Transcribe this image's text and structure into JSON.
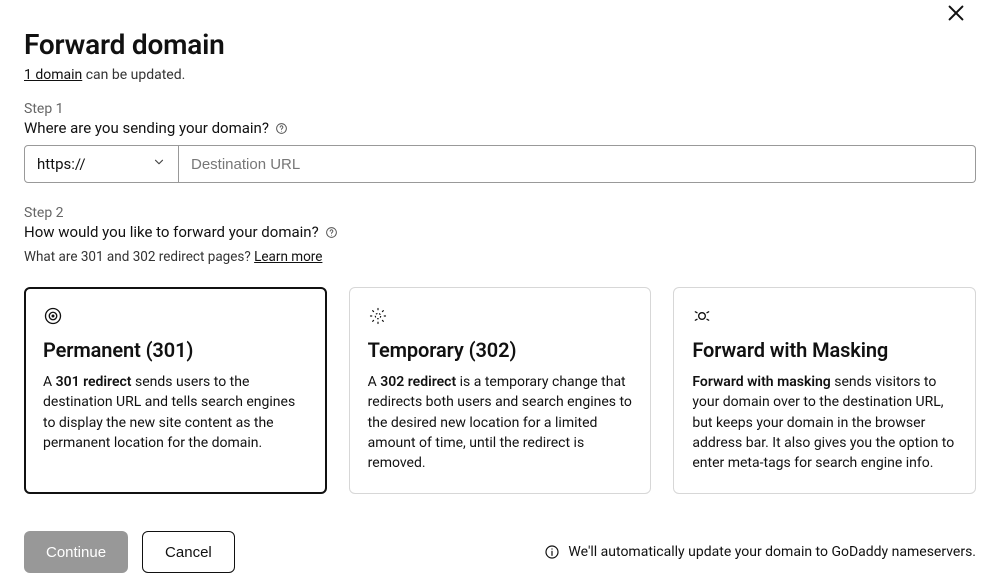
{
  "title": "Forward domain",
  "subtitle_link": "1 domain",
  "subtitle_rest": " can be updated.",
  "step1": {
    "label": "Step 1",
    "question": "Where are you sending your domain?",
    "protocol": "https://",
    "dest_placeholder": "Destination URL",
    "dest_value": ""
  },
  "step2": {
    "label": "Step 2",
    "question": "How would you like to forward your domain?",
    "hint_prefix": "What are 301 and 302 redirect pages? ",
    "learn_more": "Learn more"
  },
  "cards": {
    "permanent": {
      "title": "Permanent (301)",
      "desc_prefix": "A ",
      "desc_bold": "301 redirect",
      "desc_rest": " sends users to the destination URL and tells search engines to display the new site content as the permanent location for the domain."
    },
    "temporary": {
      "title": "Temporary (302)",
      "desc_prefix": "A ",
      "desc_bold": "302 redirect",
      "desc_rest": " is a temporary change that redirects both users and search engines to the desired new location for a limited amount of time, until the redirect is removed."
    },
    "masking": {
      "title": "Forward with Masking",
      "desc_prefix": "",
      "desc_bold": "Forward with masking",
      "desc_rest": " sends visitors to your domain over to the destination URL, but keeps your domain in the browser address bar. It also gives you the option to enter meta-tags for search engine info."
    }
  },
  "footer": {
    "continue": "Continue",
    "cancel": "Cancel",
    "note": "We'll automatically update your domain to GoDaddy nameservers."
  }
}
